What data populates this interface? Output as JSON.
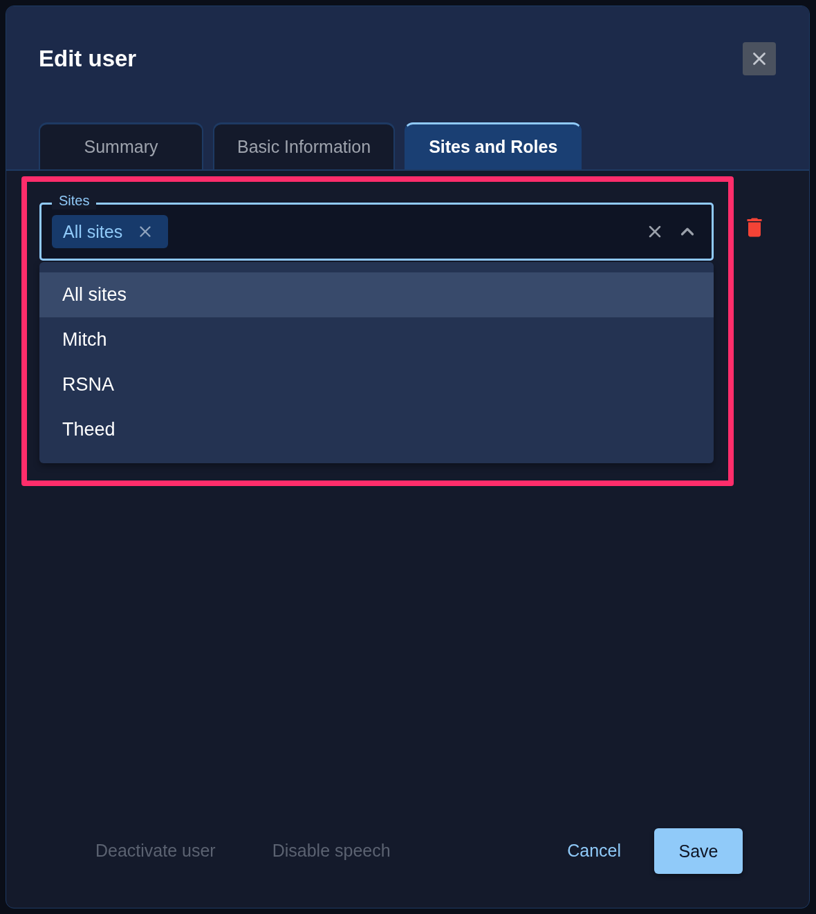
{
  "dialog": {
    "title": "Edit user"
  },
  "tabs": [
    {
      "label": "Summary",
      "selected": false
    },
    {
      "label": "Basic Information",
      "selected": false
    },
    {
      "label": "Sites and Roles",
      "selected": true
    }
  ],
  "sites_field": {
    "label": "Sites",
    "chips": [
      {
        "label": "All sites"
      }
    ],
    "expanded": true
  },
  "options": [
    {
      "label": "All sites",
      "selected": true
    },
    {
      "label": "Mitch",
      "selected": false
    },
    {
      "label": "RSNA",
      "selected": false
    },
    {
      "label": "Theed",
      "selected": false
    }
  ],
  "footer": {
    "actions": [
      {
        "label": "Deactivate user",
        "disabled": true
      },
      {
        "label": "Disable speech",
        "disabled": true
      }
    ],
    "cancel": "Cancel",
    "save": "Save"
  }
}
